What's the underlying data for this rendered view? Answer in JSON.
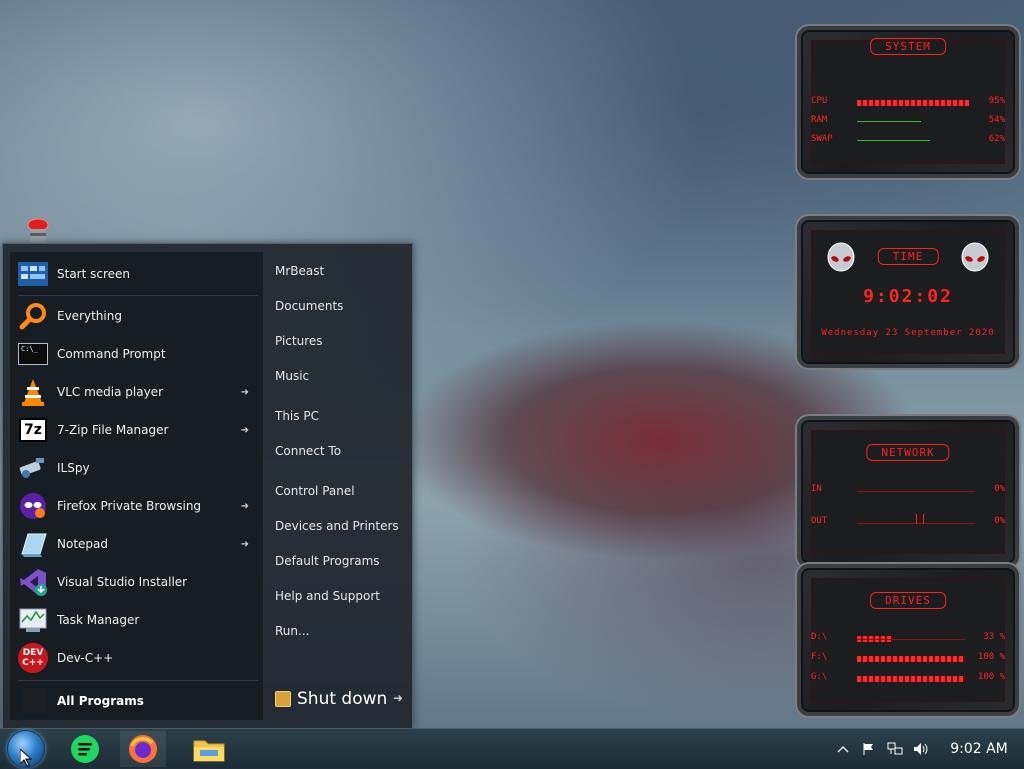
{
  "start_menu": {
    "apps": [
      {
        "label": "Start screen",
        "icon": "start-screen-icon",
        "has_arrow": false
      },
      {
        "label": "Everything",
        "icon": "search-magnifier-icon",
        "has_arrow": false
      },
      {
        "label": "Command Prompt",
        "icon": "command-prompt-icon",
        "has_arrow": false
      },
      {
        "label": "VLC media player",
        "icon": "vlc-cone-icon",
        "has_arrow": true
      },
      {
        "label": "7-Zip File Manager",
        "icon": "7zip-icon",
        "has_arrow": true
      },
      {
        "label": "ILSpy",
        "icon": "ilspy-icon",
        "has_arrow": false
      },
      {
        "label": "Firefox Private Browsing",
        "icon": "firefox-private-icon",
        "has_arrow": true
      },
      {
        "label": "Notepad",
        "icon": "notepad-icon",
        "has_arrow": true
      },
      {
        "label": "Visual Studio Installer",
        "icon": "visual-studio-installer-icon",
        "has_arrow": false
      },
      {
        "label": "Task Manager",
        "icon": "task-manager-icon",
        "has_arrow": false
      },
      {
        "label": "Dev-C++",
        "icon": "dev-cpp-icon",
        "has_arrow": false
      }
    ],
    "seven_zip_badge": "7z",
    "cmd_badge": "C:\\_",
    "devcpp_badge_top": "DEV",
    "devcpp_badge_bottom": "C++",
    "all_programs": "All Programs",
    "right_items": [
      "MrBeast",
      "Documents",
      "Pictures",
      "Music",
      "This PC",
      "Connect To",
      "Control Panel",
      "Devices and Printers",
      "Default Programs",
      "Help and Support",
      "Run..."
    ],
    "shutdown_label": "Shut down",
    "arrow_glyph": "➜"
  },
  "taskbar": {
    "clock": "9:02 AM",
    "apps": [
      "start-orb",
      "spotify-like-app",
      "firefox",
      "file-explorer"
    ],
    "tray_icons": [
      "chevron-up-icon",
      "flag-icon",
      "network-icon",
      "volume-icon"
    ]
  },
  "widgets": {
    "system": {
      "title": "SYSTEM",
      "rows": [
        {
          "label": "CPU",
          "value": "95%",
          "fill": 0.95
        },
        {
          "label": "RAM",
          "value": "54%",
          "fill": 0.54
        },
        {
          "label": "SWAP",
          "value": "62%",
          "fill": 0.62
        }
      ]
    },
    "time": {
      "title": "TIME",
      "clock": "9:02:02",
      "date": "Wednesday 23 September 2020"
    },
    "network": {
      "title": "NETWORK",
      "rows": [
        {
          "label": "IN",
          "value": "0%"
        },
        {
          "label": "OUT",
          "value": "0%"
        }
      ]
    },
    "drives": {
      "title": "DRIVES",
      "rows": [
        {
          "label": "D:\\",
          "value": "33 %",
          "fill": 0.33
        },
        {
          "label": "F:\\",
          "value": "100 %",
          "fill": 1.0
        },
        {
          "label": "G:\\",
          "value": "100 %",
          "fill": 1.0
        }
      ]
    }
  },
  "colors": {
    "widget_red": "#ff2020",
    "menu_bg": "#1c242a",
    "taskbar_bg": "#19282f"
  }
}
